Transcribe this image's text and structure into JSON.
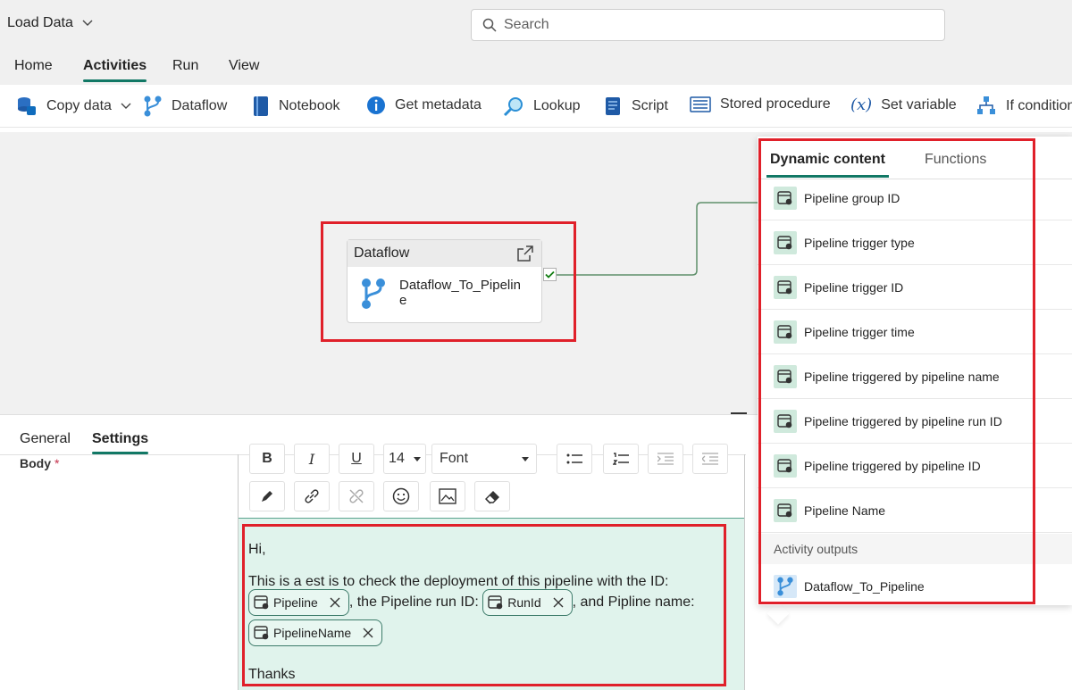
{
  "title_bar": {
    "title": "Load Data",
    "search_placeholder": "Search"
  },
  "menu": {
    "tabs": [
      "Home",
      "Activities",
      "Run",
      "View"
    ],
    "active": "Activities"
  },
  "toolbar": {
    "items": [
      {
        "label": "Copy data",
        "icon": "copy-data-icon"
      },
      {
        "label": "Dataflow",
        "icon": "dataflow-icon"
      },
      {
        "label": "Notebook",
        "icon": "notebook-icon"
      },
      {
        "label": "Get metadata",
        "icon": "info-icon"
      },
      {
        "label": "Lookup",
        "icon": "lookup-icon"
      },
      {
        "label": "Script",
        "icon": "script-icon"
      },
      {
        "label": "Stored procedure",
        "icon": "stored-procedure-icon"
      },
      {
        "label": "Set variable",
        "icon": "variable-icon"
      },
      {
        "label": "If condition",
        "icon": "if-condition-icon"
      }
    ]
  },
  "canvas": {
    "activity": {
      "type": "Dataflow",
      "name": "Dataflow_To_Pipeline"
    }
  },
  "bottom_panel": {
    "tabs": [
      "General",
      "Settings"
    ],
    "active": "Settings",
    "body_label": "Body",
    "required_mark": "*",
    "font_size": "14",
    "font": "Font",
    "editor": {
      "line1": "Hi,",
      "line2": "This is a  est is to check the deployment of this pipeline with the ID:",
      "chip1": "Pipeline",
      "text_after_chip1": ", the Pipeline run ID:",
      "chip2": "RunId",
      "text_after_chip2": ", and Pipline name:",
      "chip3": "PipelineName",
      "closing": "Thanks"
    }
  },
  "flyout": {
    "tabs": [
      "Dynamic content",
      "Functions"
    ],
    "active": "Dynamic content",
    "items": [
      "Pipeline group ID",
      "Pipeline trigger type",
      "Pipeline trigger ID",
      "Pipeline trigger time",
      "Pipeline triggered by pipeline name",
      "Pipeline triggered by pipeline run ID",
      "Pipeline triggered by pipeline ID",
      "Pipeline Name"
    ],
    "section": "Activity outputs",
    "outputs": [
      "Dataflow_To_Pipeline"
    ]
  },
  "colors": {
    "accent": "#117865",
    "highlight": "#e0202a",
    "editor_bg": "#e0f3ec"
  }
}
